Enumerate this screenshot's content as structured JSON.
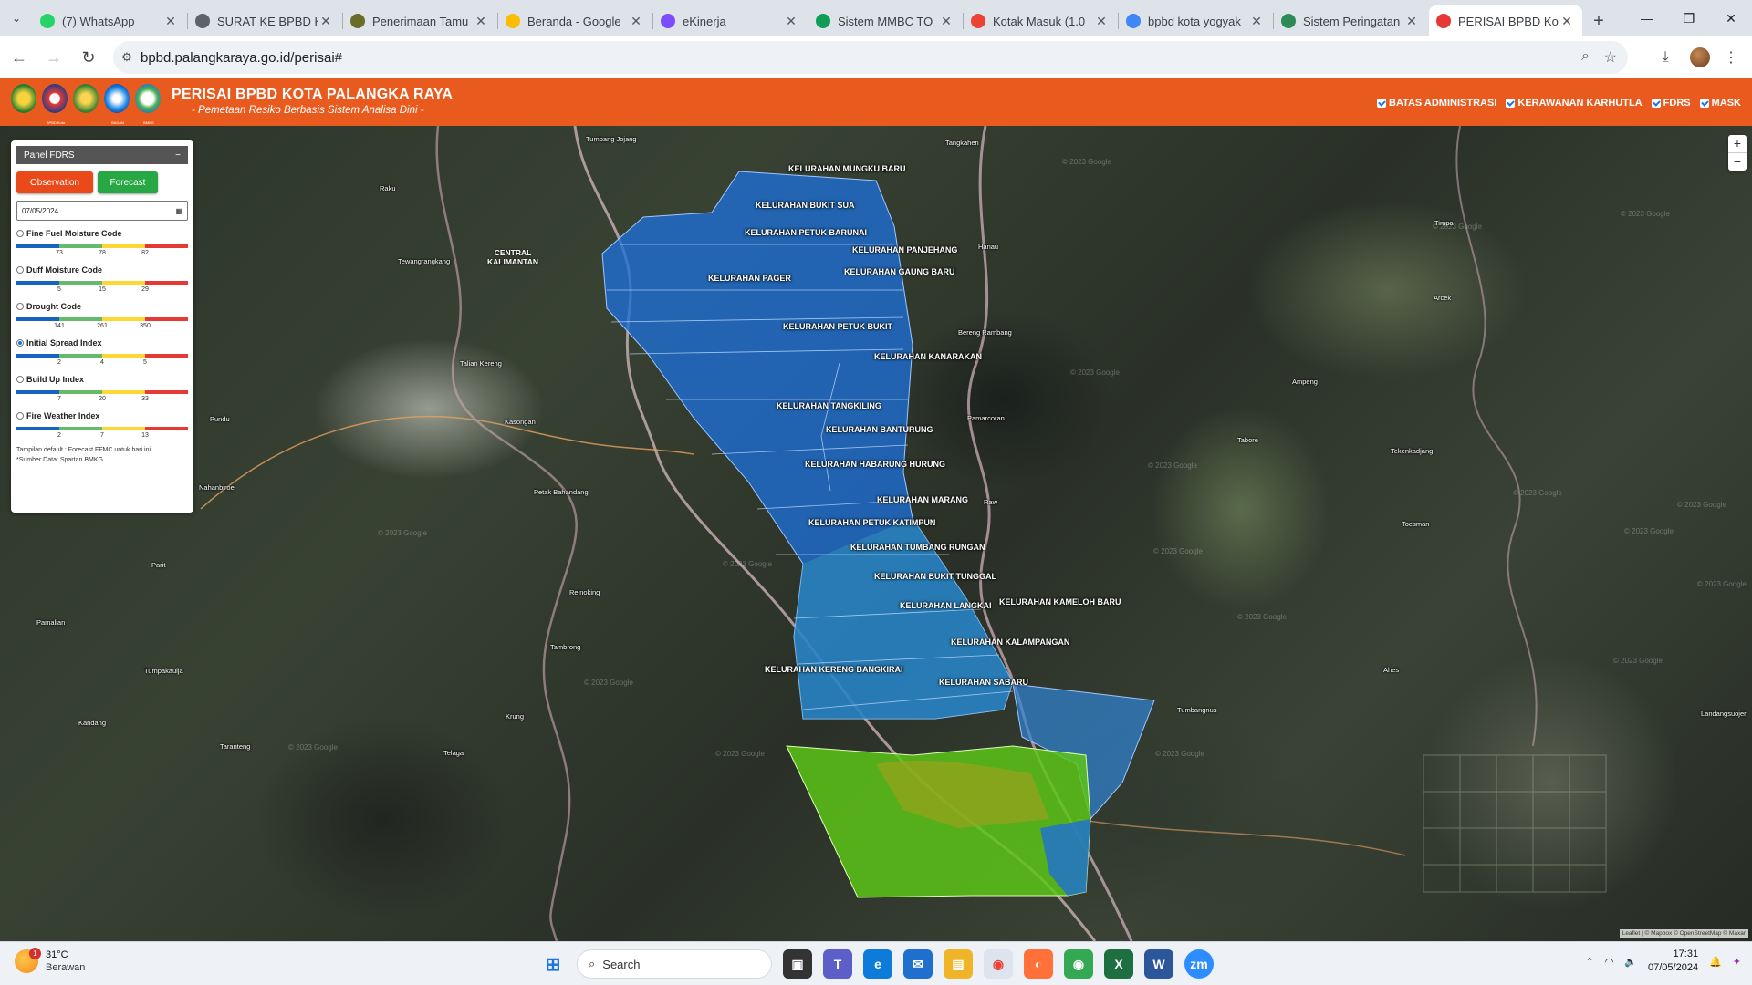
{
  "browser": {
    "tabs": [
      {
        "title": "(7) WhatsApp",
        "icon": "whatsapp-icon",
        "color": "#25d366"
      },
      {
        "title": "SURAT KE BPBD K",
        "icon": "globe-icon",
        "color": "#5f6368"
      },
      {
        "title": "Penerimaan Tamu",
        "icon": "shield-icon",
        "color": "#6b6b2a"
      },
      {
        "title": "Beranda - Google",
        "icon": "drive-icon",
        "color": "#fbbc04"
      },
      {
        "title": "eKinerja",
        "icon": "ekinerja-icon",
        "color": "#7c4dff"
      },
      {
        "title": "Sistem MMBC TO",
        "icon": "sheets-icon",
        "color": "#0f9d58"
      },
      {
        "title": "Kotak Masuk (1.0",
        "icon": "gmail-icon",
        "color": "#ea4335"
      },
      {
        "title": "bpbd kota yogyak",
        "icon": "google-icon",
        "color": "#4285f4"
      },
      {
        "title": "Sistem Peringatan",
        "icon": "wave-icon",
        "color": "#2e8b57"
      },
      {
        "title": "PERISAI BPBD Kot",
        "icon": "bpbd-icon",
        "color": "#e53935"
      }
    ],
    "active_tab": 9,
    "url": "bpbd.palangkaraya.go.id/perisai#"
  },
  "header": {
    "logo_captions": [
      "",
      "BPBD Kota Palangka Raya",
      "",
      "BADAN METEOROLOGI",
      "BMKG"
    ],
    "title": "PERISAI BPBD KOTA PALANGKA RAYA",
    "subtitle": "- Pemetaan Resiko Berbasis Sistem Analisa Dini -",
    "layers": [
      {
        "label": "BATAS ADMINISTRASI",
        "checked": true
      },
      {
        "label": "KERAWANAN KARHUTLA",
        "checked": true
      },
      {
        "label": "FDRS",
        "checked": true
      },
      {
        "label": "MASK",
        "checked": true
      }
    ]
  },
  "panel": {
    "title": "Panel FDRS",
    "collapse": "−",
    "observation_label": "Observation",
    "forecast_label": "Forecast",
    "date": "07/05/2024",
    "indices": [
      {
        "label": "Fine Fuel Moisture Code",
        "ticks": [
          "73",
          "78",
          "82"
        ],
        "selected": false
      },
      {
        "label": "Duff Moisture Code",
        "ticks": [
          "5",
          "15",
          "29"
        ],
        "selected": false
      },
      {
        "label": "Drought Code",
        "ticks": [
          "141",
          "261",
          "350"
        ],
        "selected": false
      },
      {
        "label": "Initial Spread Index",
        "ticks": [
          "2",
          "4",
          "5"
        ],
        "selected": true
      },
      {
        "label": "Build Up Index",
        "ticks": [
          "7",
          "20",
          "33"
        ],
        "selected": false
      },
      {
        "label": "Fire Weather Index",
        "ticks": [
          "2",
          "7",
          "13"
        ],
        "selected": false
      }
    ],
    "scale_colors": [
      "#1565c0",
      "#66bb6a",
      "#fdd835",
      "#e53935"
    ],
    "note1": "Tampilan default : Forecast FFMC untuk hari ini",
    "note2": "*Sumber Data: Spartan BMKG"
  },
  "map": {
    "kelurahan": [
      "KELURAHAN MUNGKU BARU",
      "KELURAHAN BUKIT SUA",
      "KELURAHAN PETUK BARUNAI",
      "KELURAHAN PANJEHANG",
      "KELURAHAN GAUNG BARU",
      "KELURAHAN PAGER",
      "KELURAHAN PETUK BUKIT",
      "KELURAHAN KANARAKAN",
      "KELURAHAN TANGKILING",
      "KELURAHAN BANTURUNG",
      "KELURAHAN HABARUNG HURUNG",
      "KELURAHAN MARANG",
      "KELURAHAN PETUK KATIMPUN",
      "KELURAHAN TUMBANG RUNGAN",
      "KELURAHAN BUKIT TUNGGAL",
      "KELURAHAN KAMELOH BARU",
      "KELURAHAN LANGKAI",
      "KELURAHAN KALAMPANGAN",
      "KELURAHAN KERENG BANGKIRAI",
      "KELURAHAN SABARU"
    ],
    "places": [
      "Tumbang Jojang",
      "Tangkahen",
      "Raku",
      "Tewangrangkang",
      "Hanau",
      "Timpa",
      "Arcek",
      "Bereng Rambang",
      "Talian Kereng",
      "Ampeng",
      "Pundu",
      "Kasongan",
      "Pamarcoran",
      "Tabore",
      "Tekenkadjang",
      "Nahanbiroe",
      "Petak Bahandang",
      "Raw",
      "Toesman",
      "Parit",
      "Reinoking",
      "Pamalian",
      "Tambrong",
      "Ahes",
      "Tumpakaulja",
      "Tumbangnus",
      "Kandang",
      "Krung",
      "Taranteng",
      "Telaga",
      "Landangsuojer"
    ],
    "region_label": "CENTRAL KALIMANTAN",
    "watermark": "© 2023 Google",
    "attribution": "Leaflet | © Mapbox © OpenStreetMap © Maxar"
  },
  "taskbar": {
    "temperature": "31°C",
    "weather": "Berawan",
    "weather_badge": "1",
    "search_placeholder": "Search",
    "time": "17:31",
    "date": "07/05/2024"
  }
}
